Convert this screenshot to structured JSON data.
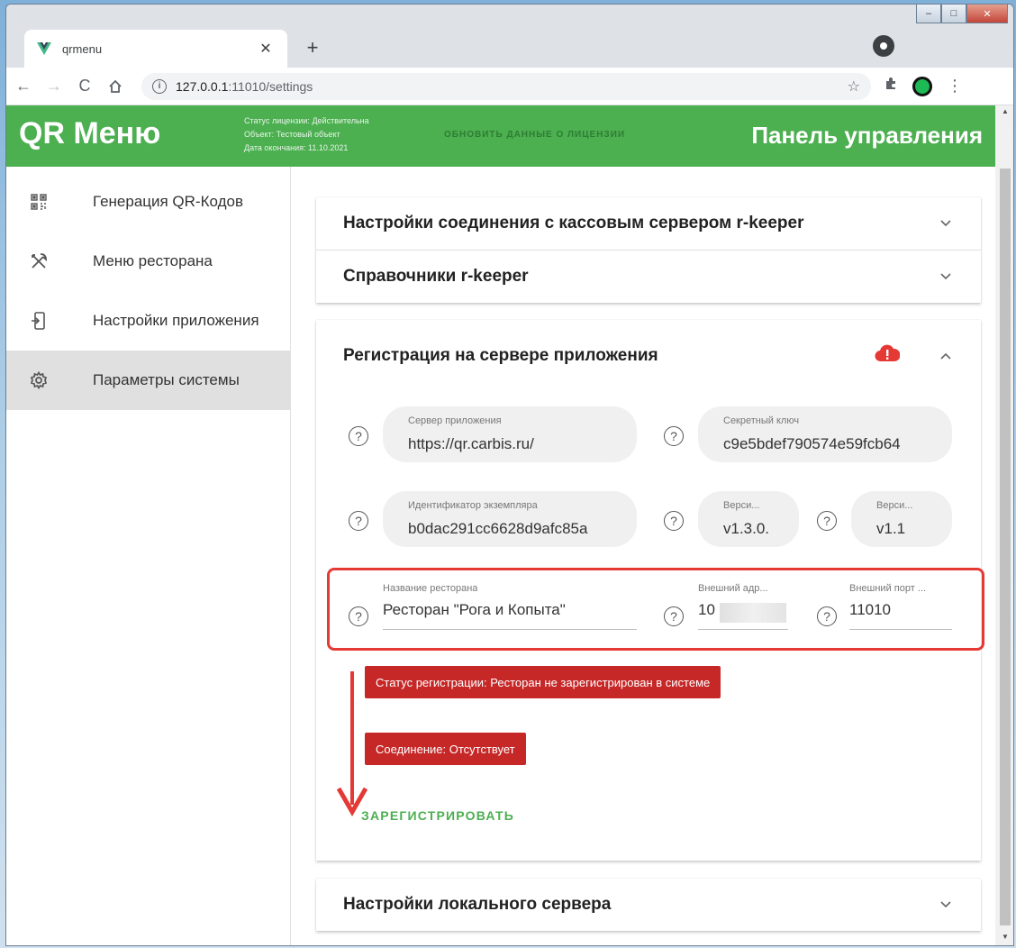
{
  "browser": {
    "tab_title": "qrmenu",
    "url_host": "127.0.0.1",
    "url_rest": ":11010/settings"
  },
  "header": {
    "logo": "QR Меню",
    "license_status": "Статус лицензии: Действительна",
    "license_object": "Объект: Тестовый объект",
    "license_expiry": "Дата окончания: 11.10.2021",
    "refresh_license": "обновить данные о лицензии",
    "panel_title": "Панель управления"
  },
  "sidebar": {
    "items": [
      {
        "label": "Генерация QR-Кодов",
        "icon": "qr-code-icon"
      },
      {
        "label": "Меню ресторана",
        "icon": "cutlery-icon"
      },
      {
        "label": "Настройки приложения",
        "icon": "app-settings-icon"
      },
      {
        "label": "Параметры системы",
        "icon": "gear-icon",
        "active": true
      }
    ]
  },
  "panels": {
    "rkeeper_connection": "Настройки соединения с кассовым сервером r-keeper",
    "rkeeper_dicts": "Справочники r-keeper",
    "registration": "Регистрация на сервере приложения",
    "local_server": "Настройки локального сервера"
  },
  "registration": {
    "app_server_label": "Сервер приложения",
    "app_server_value": "https://qr.carbis.ru/",
    "secret_key_label": "Секретный ключ",
    "secret_key_value": "c9e5bdef790574e59fcb64",
    "instance_id_label": "Идентификатор экземпляра",
    "instance_id_value": "b0dac291cc6628d9afc85a",
    "version1_label": "Верси...",
    "version1_value": "v1.3.0.",
    "version2_label": "Верси...",
    "version2_value": "v1.1",
    "restaurant_name_label": "Название ресторана",
    "restaurant_name_value": "Ресторан \"Рога и Копыта\"",
    "ext_address_label": "Внешний адр...",
    "ext_address_value": "10",
    "ext_port_label": "Внешний порт ...",
    "ext_port_value": "11010",
    "status_registration": "Статус регистрации: Ресторан не зарегистрирован в системе",
    "status_connection": "Соединение: Отсутствует",
    "register_button": "ЗАРЕГИСТРИРОВАТЬ"
  },
  "colors": {
    "brand_green": "#4caf50",
    "error_red": "#c62828",
    "highlight_red": "#e53935"
  }
}
